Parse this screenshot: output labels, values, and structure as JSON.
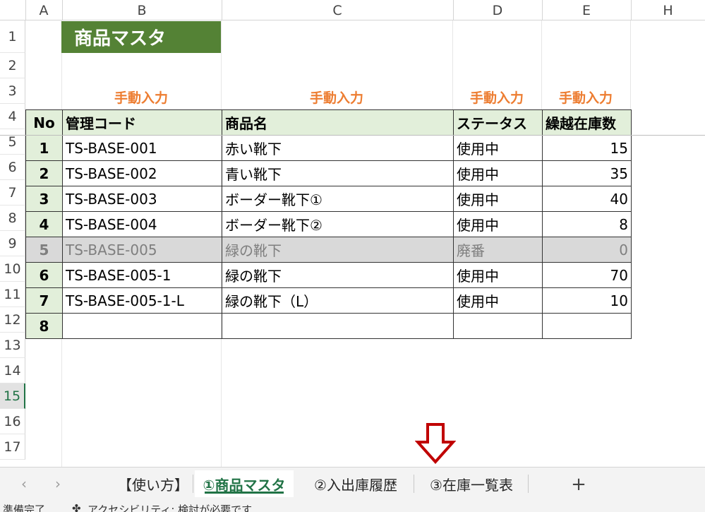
{
  "columns": [
    "A",
    "B",
    "C",
    "D",
    "E",
    "H"
  ],
  "rows": [
    "1",
    "2",
    "3",
    "4",
    "5",
    "6",
    "7",
    "8",
    "9",
    "10",
    "11",
    "12",
    "13",
    "14",
    "15",
    "16",
    "17"
  ],
  "active_row": "15",
  "title": "商品マスタ",
  "manual_input_label": "手動入力",
  "table": {
    "headers": [
      "No",
      "管理コード",
      "商品名",
      "ステータス",
      "繰越在庫数"
    ],
    "rows": [
      {
        "no": "1",
        "code": "TS-BASE-001",
        "name": "赤い靴下",
        "status": "使用中",
        "qty": "15"
      },
      {
        "no": "2",
        "code": "TS-BASE-002",
        "name": "青い靴下",
        "status": "使用中",
        "qty": "35"
      },
      {
        "no": "3",
        "code": "TS-BASE-003",
        "name": "ボーダー靴下①",
        "status": "使用中",
        "qty": "40"
      },
      {
        "no": "4",
        "code": "TS-BASE-004",
        "name": "ボーダー靴下②",
        "status": "使用中",
        "qty": "8"
      },
      {
        "no": "5",
        "code": "TS-BASE-005",
        "name": "緑の靴下",
        "status": "廃番",
        "qty": "0"
      },
      {
        "no": "6",
        "code": "TS-BASE-005-1",
        "name": "緑の靴下",
        "status": "使用中",
        "qty": "70"
      },
      {
        "no": "7",
        "code": "TS-BASE-005-1-L",
        "name": "緑の靴下（L）",
        "status": "使用中",
        "qty": "10"
      },
      {
        "no": "8",
        "code": "",
        "name": "",
        "status": "",
        "qty": ""
      }
    ]
  },
  "sheet_tabs": [
    "【使い方】",
    "①商品マスタ",
    "②入出庫履歴",
    "③在庫一覧表"
  ],
  "active_tab": "①商品マスタ",
  "nav": {
    "prev": "‹",
    "next": "›",
    "add": "+"
  },
  "status_bar": {
    "ready": "準備完了",
    "accessibility": "アクセシビリティ: 検討が必要です"
  },
  "colors": {
    "title_bg": "#548235",
    "header_bg": "#e2efda",
    "manual_input": "#ed7d31",
    "disabled_row": "#d9d9d9",
    "arrow": "#c00000",
    "excel_green": "#217346"
  }
}
